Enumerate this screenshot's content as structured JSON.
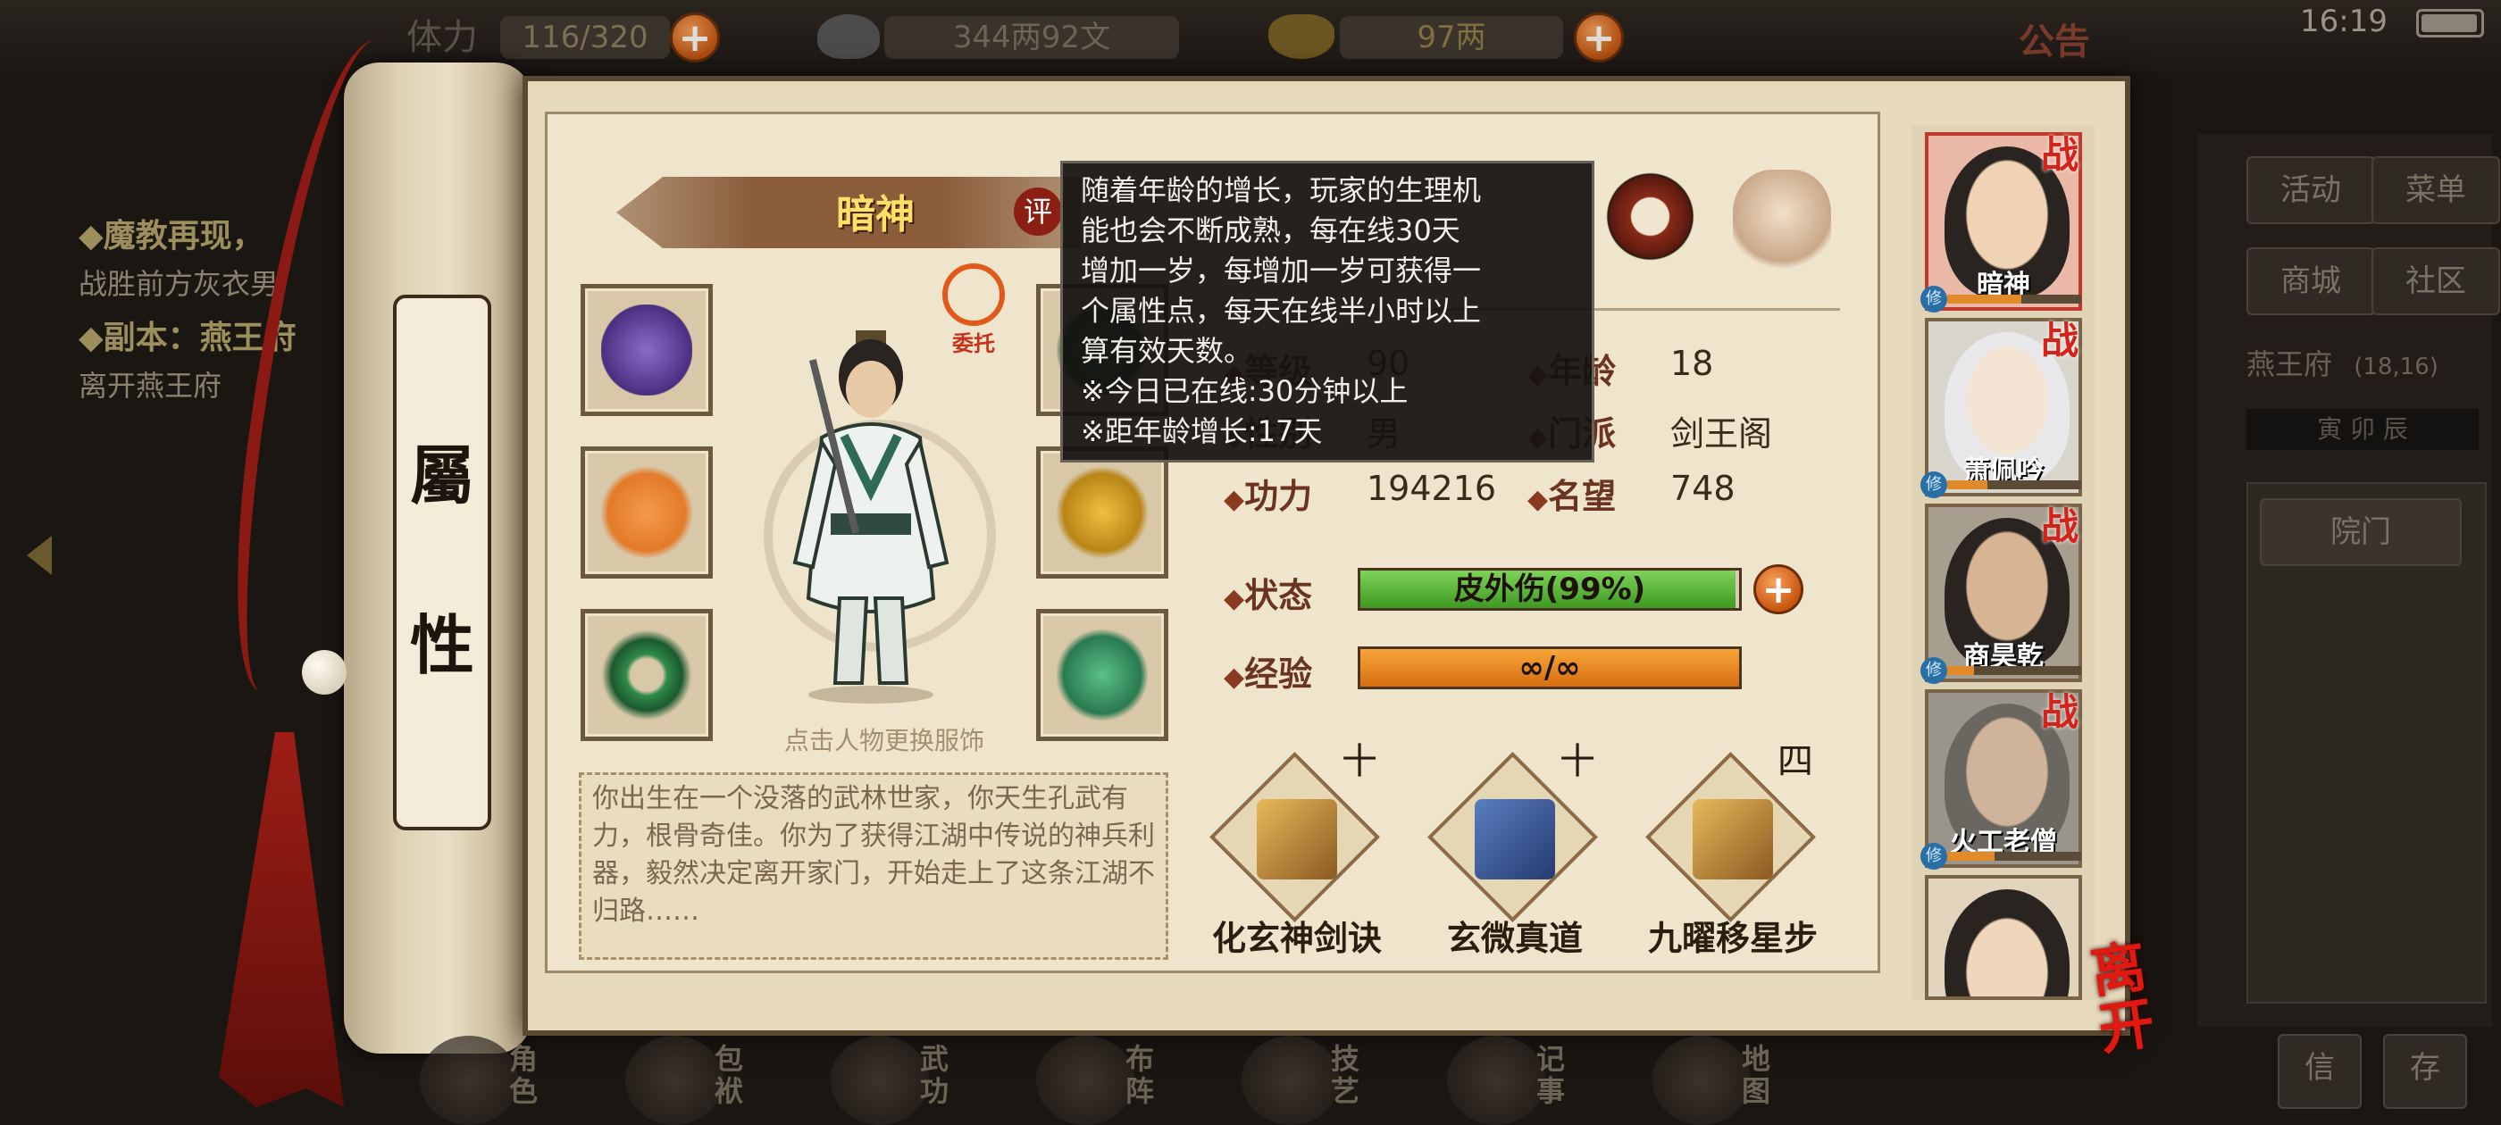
{
  "topbar": {
    "stamina": "116/320",
    "silver": "344两92文",
    "gold": "97两",
    "notice": "公告",
    "clock": "16:19"
  },
  "quests": [
    {
      "title": "◆魔教再现，",
      "desc": "战胜前方灰衣男"
    },
    {
      "title": "◆副本：燕王府",
      "desc": "离开燕王府"
    }
  ],
  "scroll": {
    "char1": "屬",
    "char2": "性"
  },
  "character": {
    "name": "暗神",
    "rate_badge": "评",
    "entrust": "委托",
    "hint": "点击人物更换服饰",
    "bio": "你出生在一个没落的武林世家，你天生孔武有力，根骨奇佳。你为了获得江湖中传说的神兵利器，毅然决定离开家门，开始走上了这条江湖不归路……"
  },
  "stats": {
    "level_label": "等级",
    "level_value": "90",
    "age_label": "年龄",
    "age_value": "18",
    "gender_label": "性别",
    "gender_value": "男",
    "sect_label": "门派",
    "sect_value": "剑王阁",
    "power_label": "功力",
    "power_value": "194216",
    "fame_label": "名望",
    "fame_value": "748",
    "status_label": "状态",
    "status_value": "皮外伤(99%)",
    "status_fill": 0.99,
    "exp_label": "经验",
    "exp_value": "∞/∞",
    "exp_fill": 1.0
  },
  "skills": [
    {
      "name": "化玄神剑诀",
      "level": "十"
    },
    {
      "name": "玄微真道",
      "level": "十"
    },
    {
      "name": "九曜移星步",
      "level": "四"
    }
  ],
  "tooltip": {
    "line1": "随着年龄的增长，玩家的生理机",
    "line2": "能也会不断成熟，每在线30天",
    "line3": "增加一岁，每增加一岁可获得一",
    "line4": "个属性点，每天在线半小时以上",
    "line5": "算有效天数。",
    "line6": "※今日已在线:30分钟以上",
    "line7": "※距年龄增长:17天"
  },
  "party": [
    {
      "name": "暗神",
      "battle": "战",
      "xiu": "修",
      "xp": 0.55
    },
    {
      "name": "萧佩吟",
      "battle": "战",
      "xiu": "修",
      "xp": 0.3
    },
    {
      "name": "商昊乾",
      "battle": "战",
      "xiu": "修",
      "xp": 0.2
    },
    {
      "name": "火工老僧",
      "battle": "战",
      "xiu": "修",
      "xp": 0.35
    },
    {
      "name": "",
      "battle": "",
      "xiu": "",
      "xp": 0
    }
  ],
  "right_menu": {
    "activity": "活动",
    "menu": "菜单",
    "shop": "商城",
    "community": "社区",
    "location": "燕王府",
    "coords": "(18,16)",
    "tabs": "寅  卯  辰",
    "courtyard": "院门",
    "mail": "信",
    "save": "存"
  },
  "leave": "离开",
  "bottom_nav": [
    {
      "label": "角色"
    },
    {
      "label": "包袱"
    },
    {
      "label": "武功"
    },
    {
      "label": "布阵"
    },
    {
      "label": "技艺"
    },
    {
      "label": "记事"
    },
    {
      "label": "地图"
    }
  ],
  "colors": {
    "accent": "#e4772a",
    "status_bar": "#57b52f",
    "exp_bar": "#e8891e",
    "name_gold": "#ffe066",
    "battle_red": "#d4231a"
  }
}
